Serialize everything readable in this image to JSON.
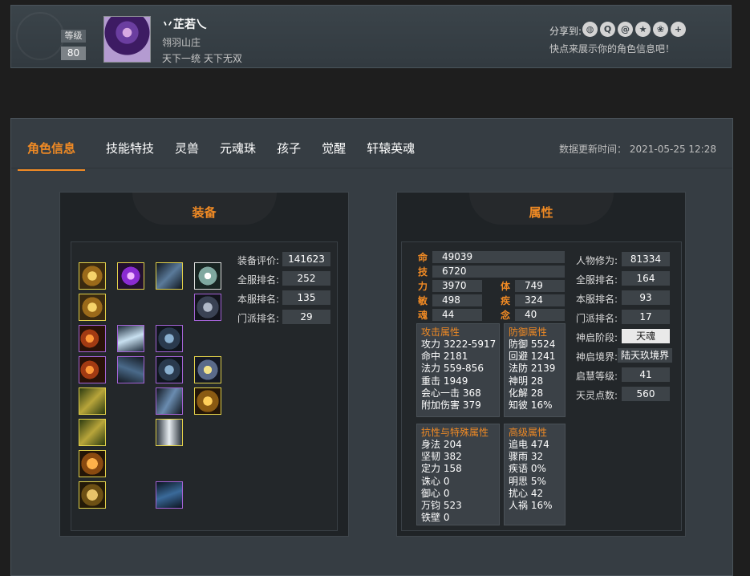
{
  "profile": {
    "level_label": "等级",
    "level_value": "80",
    "name": "丷芷若乀",
    "guild": "翎羽山庄",
    "motto": "天下一统 天下无双",
    "share_label": "分享到:",
    "share_icons": [
      "wechat-icon",
      "qq-icon",
      "weibo-icon",
      "qzone-icon",
      "tieba-icon",
      "plus-icon"
    ],
    "share_hint": "快点来展示你的角色信息吧！"
  },
  "tabs": [
    "角色信息",
    "技能特技",
    "灵兽",
    "元魂珠",
    "孩子",
    "觉醒",
    "轩辕英魂"
  ],
  "active_tab": 0,
  "update_time": "数据更新时间： 2021-05-25 12:28",
  "equipment": {
    "title": "装备",
    "stats": [
      {
        "label": "装备评价:",
        "value": "141623"
      },
      {
        "label": "全服排名:",
        "value": "252"
      },
      {
        "label": "本服排名:",
        "value": "135"
      },
      {
        "label": "门派排名:",
        "value": "29"
      }
    ]
  },
  "attributes": {
    "title": "属性",
    "hp": {
      "label": "命",
      "value": "49039"
    },
    "skill": {
      "label": "技",
      "value": "6720"
    },
    "pairs": [
      [
        {
          "label": "力",
          "value": "3970"
        },
        {
          "label": "体",
          "value": "749"
        }
      ],
      [
        {
          "label": "敏",
          "value": "498"
        },
        {
          "label": "疾",
          "value": "324"
        }
      ],
      [
        {
          "label": "魂",
          "value": "44"
        },
        {
          "label": "念",
          "value": "40"
        }
      ]
    ],
    "attack": {
      "title": "攻击属性",
      "rows": [
        "攻力 3222-5917",
        "命中 2181",
        "法力 559-856",
        "重击 1949",
        "会心一击 368",
        "附加伤害 379"
      ]
    },
    "defense": {
      "title": "防御属性",
      "rows": [
        "防御 5524",
        "回避 1241",
        "法防 2139",
        "神明 28",
        "化解 28",
        "知彼 16%"
      ]
    },
    "resist": {
      "title": "抗性与特殊属性",
      "rows": [
        "身法 204",
        "坚韧 382",
        "定力 158",
        "诛心 0",
        "御心 0",
        "万钧 523",
        "铁壁 0"
      ]
    },
    "advanced": {
      "title": "高级属性",
      "rows": [
        "追电 474",
        "骤雨 32",
        "疾语 0%",
        "明思 5%",
        "扰心 42",
        "人祸 16%"
      ]
    },
    "right_stats": [
      {
        "label": "人物修为:",
        "value": "81334"
      },
      {
        "label": "全服排名:",
        "value": "164"
      },
      {
        "label": "本服排名:",
        "value": "93"
      },
      {
        "label": "门派排名:",
        "value": "17"
      },
      {
        "label": "神启阶段:",
        "value": "天魂"
      },
      {
        "label": "神启境界:",
        "value": "陆天玖境界"
      },
      {
        "label": "启慧等级:",
        "value": "41"
      },
      {
        "label": "天灵点数:",
        "value": "560"
      }
    ]
  }
}
